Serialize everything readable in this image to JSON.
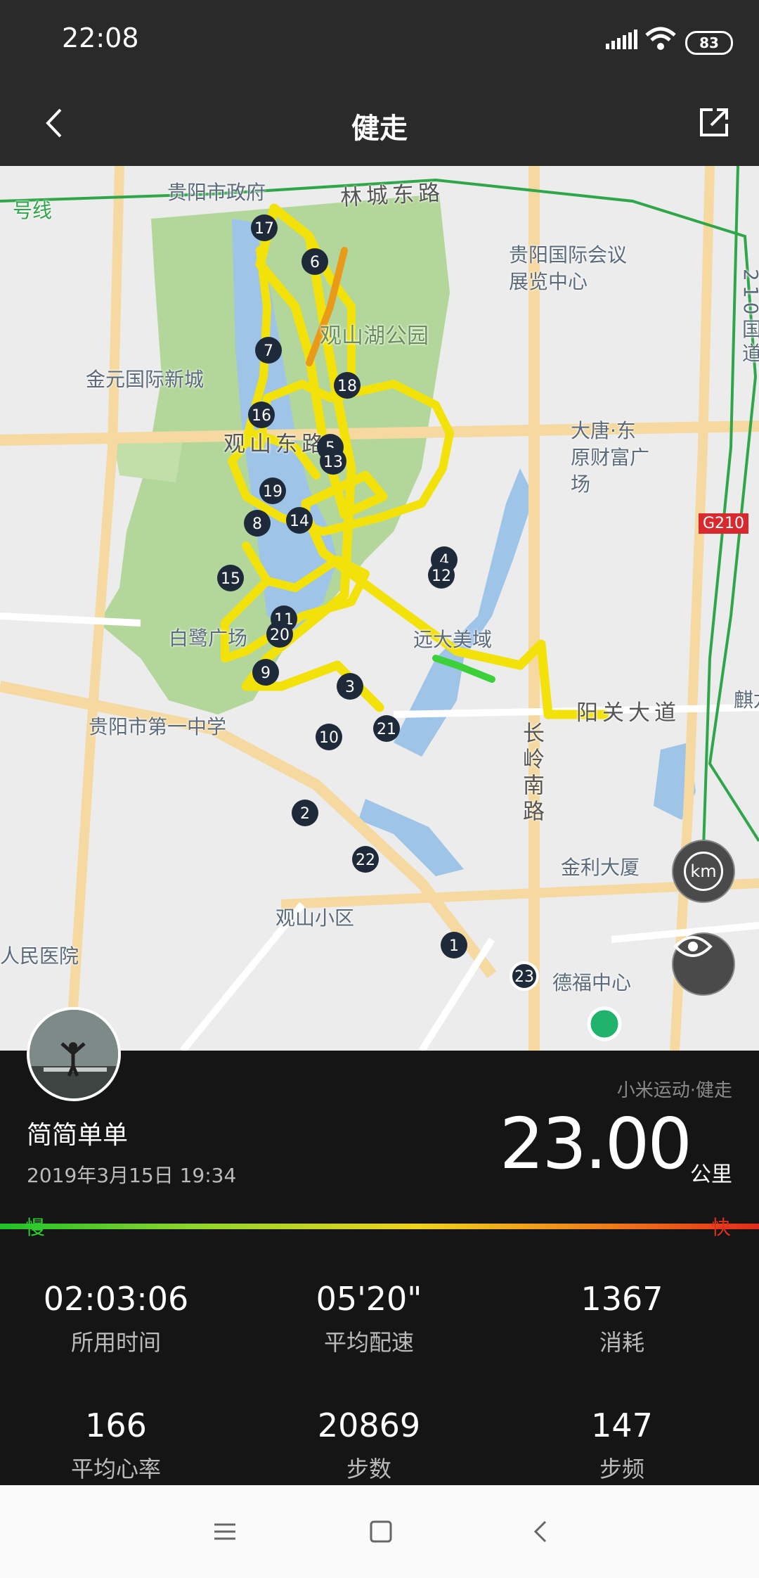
{
  "status_bar": {
    "time": "22:08",
    "battery": "83"
  },
  "header": {
    "title": "健走"
  },
  "map": {
    "labels": [
      "贵阳市政府",
      "号线",
      "林城东路",
      "贵阳国际会议展览中心",
      "观山湖公园",
      "金元国际新城",
      "观山东路",
      "大唐·东原财富广场",
      "G210",
      "210国道",
      "白鹭广场",
      "远大美域",
      "阳关大道",
      "贵阳市第一中学",
      "麒龙商",
      "长岭南路",
      "金利大厦",
      "观山小区",
      "人民医院",
      "德福中心"
    ],
    "markers": [
      "1",
      "2",
      "3",
      "4",
      "5",
      "6",
      "7",
      "8",
      "9",
      "10",
      "11",
      "12",
      "13",
      "14",
      "15",
      "16",
      "17",
      "18",
      "19",
      "20",
      "21",
      "22",
      "23"
    ],
    "km_button": "km"
  },
  "workout": {
    "username": "简简单单",
    "datetime": "2019年3月15日 19:34",
    "source": "小米运动·健走",
    "distance": "23.00",
    "distance_unit": "公里",
    "pace_slow": "慢",
    "pace_fast": "快",
    "stats": [
      {
        "value": "02:03:06",
        "label": "所用时间"
      },
      {
        "value": "05'20\"",
        "label": "平均配速"
      },
      {
        "value": "1367",
        "label": "消耗"
      },
      {
        "value": "166",
        "label": "平均心率"
      },
      {
        "value": "20869",
        "label": "步数"
      },
      {
        "value": "147",
        "label": "步频"
      }
    ]
  },
  "colors": {
    "route": "#f2e20a",
    "route_fast": "#e89a18",
    "park": "#b3d79a",
    "water": "#9ec4e8",
    "road_major": "#f5d9a0",
    "start_dot": "#21b36b"
  }
}
